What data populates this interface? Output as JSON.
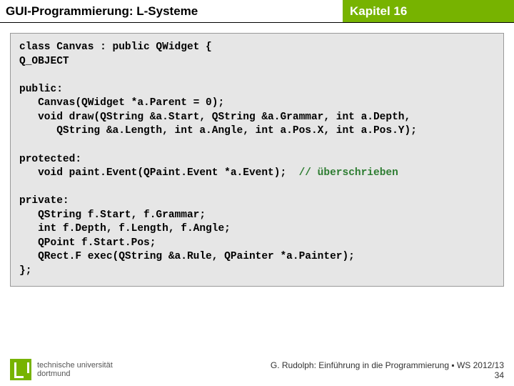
{
  "header": {
    "left": "GUI-Programmierung: L-Systeme",
    "right": "Kapitel 16"
  },
  "code": {
    "l1": "class Canvas : public QWidget {",
    "l2": "Q_OBJECT",
    "l3": "",
    "l4": "public:",
    "l5": "   Canvas(QWidget *a.Parent = 0);",
    "l6": "   void draw(QString &a.Start, QString &a.Grammar, int a.Depth,",
    "l7": "      QString &a.Length, int a.Angle, int a.Pos.X, int a.Pos.Y);",
    "l8": "",
    "l9": "protected:",
    "l10": "   void paint.Event(QPaint.Event *a.Event);  ",
    "l10c": "// überschrieben",
    "l11": "",
    "l12": "private:",
    "l13": "   QString f.Start, f.Grammar;",
    "l14": "   int f.Depth, f.Length, f.Angle;",
    "l15": "   QPoint f.Start.Pos;",
    "l16": "   QRect.F exec(QString &a.Rule, QPainter *a.Painter);",
    "l17": "};"
  },
  "footer": {
    "uni1": "technische universität",
    "uni2": "dortmund",
    "credit": "G. Rudolph: Einführung in die Programmierung ▪ WS 2012/13",
    "page": "34"
  }
}
